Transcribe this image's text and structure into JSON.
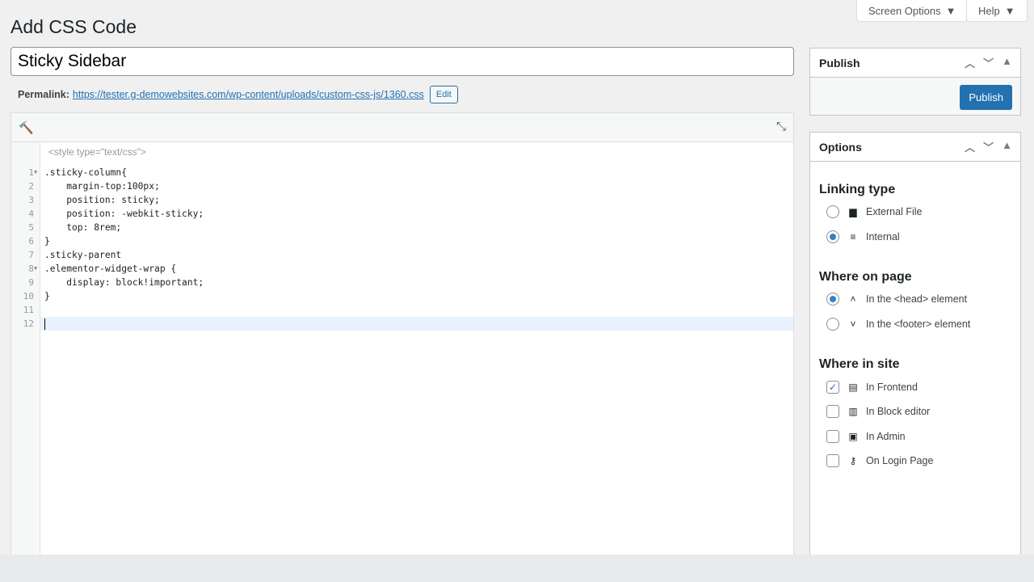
{
  "header": {
    "screen_options": "Screen Options",
    "help": "Help",
    "title": "Add CSS Code"
  },
  "post": {
    "title": "Sticky Sidebar",
    "permalink_label": "Permalink:",
    "permalink_url": "https://tester.g-demowebsites.com/wp-content/uploads/custom-css-js/",
    "permalink_id": "1360",
    "permalink_ext": ".css",
    "edit_label": "Edit"
  },
  "editor": {
    "style_tag": "<style type=\"text/css\">",
    "lines": [
      ".sticky-column{",
      "    margin-top:100px;",
      "    position: sticky;",
      "    position: -webkit-sticky;",
      "    top: 8rem;",
      "}",
      ".sticky-parent",
      ".elementor-widget-wrap {",
      "    display: block!important;",
      "}",
      "",
      ""
    ]
  },
  "publish": {
    "title": "Publish",
    "button": "Publish"
  },
  "options": {
    "title": "Options",
    "linking_type": {
      "label": "Linking type",
      "items": [
        {
          "label": "External File",
          "checked": false
        },
        {
          "label": "Internal",
          "checked": true
        }
      ]
    },
    "where_on_page": {
      "label": "Where on page",
      "items": [
        {
          "label": "In the <head> element",
          "checked": true
        },
        {
          "label": "In the <footer> element",
          "checked": false
        }
      ]
    },
    "where_in_site": {
      "label": "Where in site",
      "items": [
        {
          "label": "In Frontend",
          "checked": true
        },
        {
          "label": "In Block editor",
          "checked": false
        },
        {
          "label": "In Admin",
          "checked": false
        },
        {
          "label": "On Login Page",
          "checked": false
        }
      ]
    }
  },
  "colors": {
    "accent": "#2271b1"
  }
}
